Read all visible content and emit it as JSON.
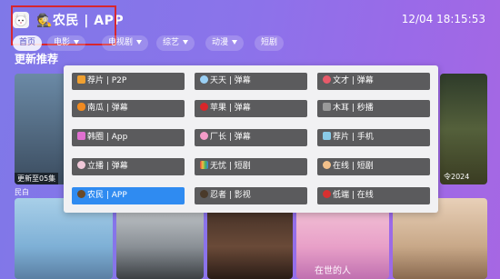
{
  "header": {
    "app_title": "🕵️农民 | APP",
    "clock": "12/04 18:15:53"
  },
  "tabs": [
    {
      "label": "首页",
      "active": true,
      "has_arrow": false
    },
    {
      "label": "电影",
      "active": false,
      "has_arrow": true
    },
    {
      "label": "电视剧",
      "active": false,
      "has_arrow": true
    },
    {
      "label": "综艺",
      "active": false,
      "has_arrow": true
    },
    {
      "label": "动漫",
      "active": false,
      "has_arrow": true
    },
    {
      "label": "短剧",
      "active": false,
      "has_arrow": false
    }
  ],
  "section_title": "更新推荐",
  "row1_posters": [
    {
      "badge": "更新至05集",
      "caption": "民白"
    },
    {
      "badge": "",
      "caption": ""
    },
    {
      "badge": "",
      "caption": ""
    },
    {
      "badge": "",
      "caption": ""
    },
    {
      "badge": "",
      "caption": ""
    },
    {
      "badge": "",
      "caption": "令2024"
    }
  ],
  "row2_posters": [
    {
      "caption": ""
    },
    {
      "caption": ""
    },
    {
      "caption": ""
    },
    {
      "caption": "在世的人"
    },
    {
      "caption": ""
    },
    {
      "caption": ""
    }
  ],
  "source_menu": [
    {
      "label": "荐片 | P2P",
      "icon": "film-icon",
      "color": "#f0a030",
      "active": false
    },
    {
      "label": "天天 | 弹幕",
      "icon": "cloud-icon",
      "color": "#9ad0f5",
      "active": false
    },
    {
      "label": "文才 | 弹幕",
      "icon": "flower-icon",
      "color": "#e85a6a",
      "active": false
    },
    {
      "label": "南瓜 | 弹幕",
      "icon": "pumpkin-icon",
      "color": "#f08a20",
      "active": false
    },
    {
      "label": "苹果 | 弹幕",
      "icon": "apple-icon",
      "color": "#d8262a",
      "active": false
    },
    {
      "label": "木耳 | 秒播",
      "icon": "mushroom-icon",
      "color": "#9a9a9a",
      "active": false
    },
    {
      "label": "韩圈 | App",
      "icon": "unicorn-icon",
      "color": "#e070d0",
      "active": false
    },
    {
      "label": "厂长 | 弹幕",
      "icon": "blossom-icon",
      "color": "#f59cc8",
      "active": false
    },
    {
      "label": "荐片 | 手机",
      "icon": "bird-icon",
      "color": "#8acbe8",
      "active": false
    },
    {
      "label": "立播 | 弹幕",
      "icon": "rabbit-icon",
      "color": "#f0c8d8",
      "active": false
    },
    {
      "label": "无忧 | 短剧",
      "icon": "rainbow-icon",
      "color": "#f0a050",
      "active": false
    },
    {
      "label": "在线 | 短剧",
      "icon": "ok-hand-icon",
      "color": "#f2c08a",
      "active": false
    },
    {
      "label": "农民 | APP",
      "icon": "detective-icon",
      "color": "#6a4a2a",
      "active": true
    },
    {
      "label": "忍者 | 影视",
      "icon": "ninja-icon",
      "color": "#4a3a2a",
      "active": false
    },
    {
      "label": "低端 | 在线",
      "icon": "mushroom-red-icon",
      "color": "#d83030",
      "active": false
    }
  ]
}
